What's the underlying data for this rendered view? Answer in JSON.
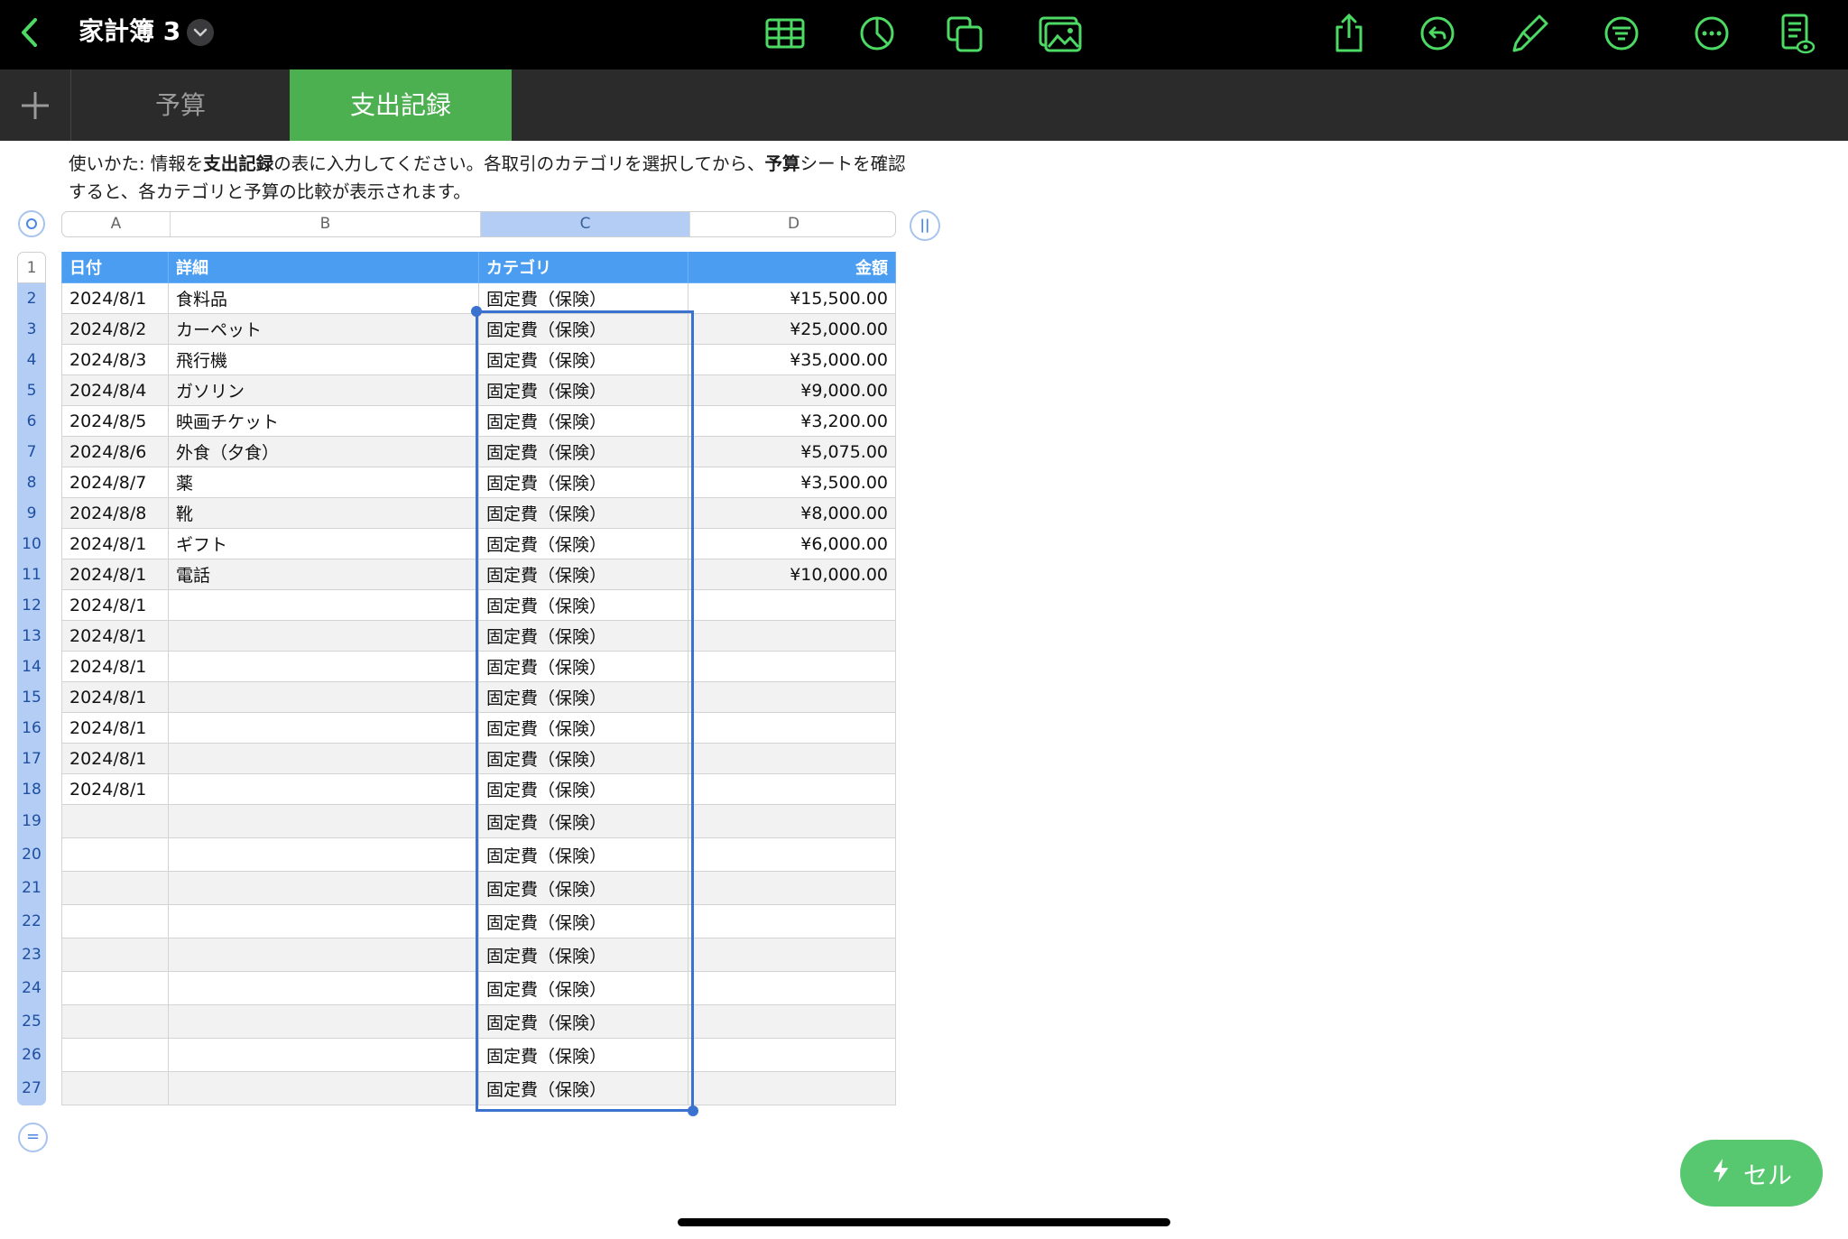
{
  "toolbar": {
    "title": "家計簿 3",
    "icons": [
      "back-chevron-icon",
      "title-menu-chevron-icon",
      "table-icon",
      "chart-icon",
      "shape-icon",
      "media-icon",
      "share-icon",
      "undo-icon",
      "format-brush-icon",
      "organize-icon",
      "more-icon",
      "reader-view-icon"
    ]
  },
  "tabs": {
    "add_icon": "plus-icon",
    "items": [
      {
        "label": "予算",
        "active": false
      },
      {
        "label": "支出記録",
        "active": true
      }
    ]
  },
  "instructions": {
    "pre": "使いかた: 情報を",
    "bold1": "支出記録",
    "mid": "の表に入力してください。各取引のカテゴリを選択してから、",
    "bold2": "予算",
    "post": "シートを確認すると、各カテゴリと予算の比較が表示されます。"
  },
  "columns": [
    "A",
    "B",
    "C",
    "D"
  ],
  "selected_column": "C",
  "table": {
    "headers": [
      "日付",
      "詳細",
      "カテゴリ",
      "金額"
    ],
    "rows": [
      [
        "2024/8/1",
        "食料品",
        "固定費（保険）",
        "¥15,500.00"
      ],
      [
        "2024/8/2",
        "カーペット",
        "固定費（保険）",
        "¥25,000.00"
      ],
      [
        "2024/8/3",
        "飛行機",
        "固定費（保険）",
        "¥35,000.00"
      ],
      [
        "2024/8/4",
        "ガソリン",
        "固定費（保険）",
        "¥9,000.00"
      ],
      [
        "2024/8/5",
        "映画チケット",
        "固定費（保険）",
        "¥3,200.00"
      ],
      [
        "2024/8/6",
        "外食（夕食）",
        "固定費（保険）",
        "¥5,075.00"
      ],
      [
        "2024/8/7",
        "薬",
        "固定費（保険）",
        "¥3,500.00"
      ],
      [
        "2024/8/8",
        "靴",
        "固定費（保険）",
        "¥8,000.00"
      ],
      [
        "2024/8/1",
        "ギフト",
        "固定費（保険）",
        "¥6,000.00"
      ],
      [
        "2024/8/1",
        "電話",
        "固定費（保険）",
        "¥10,000.00"
      ],
      [
        "2024/8/1",
        "",
        "固定費（保険）",
        ""
      ],
      [
        "2024/8/1",
        "",
        "固定費（保険）",
        ""
      ],
      [
        "2024/8/1",
        "",
        "固定費（保険）",
        ""
      ],
      [
        "2024/8/1",
        "",
        "固定費（保険）",
        ""
      ],
      [
        "2024/8/1",
        "",
        "固定費（保険）",
        ""
      ],
      [
        "2024/8/1",
        "",
        "固定費（保険）",
        ""
      ],
      [
        "2024/8/1",
        "",
        "固定費（保険）",
        ""
      ],
      [
        "",
        "",
        "固定費（保険）",
        ""
      ],
      [
        "",
        "",
        "固定費（保険）",
        ""
      ],
      [
        "",
        "",
        "固定費（保険）",
        ""
      ],
      [
        "",
        "",
        "固定費（保険）",
        ""
      ],
      [
        "",
        "",
        "固定費（保険）",
        ""
      ],
      [
        "",
        "",
        "固定費（保険）",
        ""
      ],
      [
        "",
        "",
        "固定費（保険）",
        ""
      ],
      [
        "",
        "",
        "固定費（保険）",
        ""
      ],
      [
        "",
        "",
        "固定費（保険）",
        ""
      ]
    ]
  },
  "quick_action": {
    "label": "セル",
    "icon": "lightning-icon"
  },
  "colors": {
    "accent_green": "#4caf50",
    "header_blue": "#4a9df0",
    "selection_blue": "#3b72d0"
  }
}
